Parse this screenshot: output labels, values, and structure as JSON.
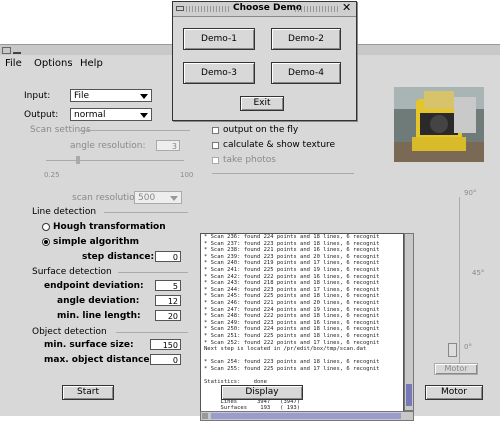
{
  "main_window": {
    "menu": [
      "File",
      "Options",
      "Help"
    ],
    "input_label": "Input:",
    "input_value": "File",
    "output_label": "Output:",
    "output_value": "normal",
    "scan_settings_label": "Scan settings",
    "angle_resolution_label": "angle resolution:",
    "angle_resolution_value": "3",
    "slider_min": "0.25",
    "slider_max": "100",
    "scan_resolution_label": "scan resolution:",
    "scan_resolution_value": "500",
    "line_detection_label": "Line detection",
    "hough_label": "Hough transformation",
    "simple_label": "simple algorithm",
    "step_distance_label": "step distance:",
    "step_distance_value": "0",
    "surface_detection_label": "Surface detection",
    "endpoint_deviation_label": "endpoint deviation:",
    "endpoint_deviation_value": "5",
    "angle_deviation_label": "angle deviation:",
    "angle_deviation_value": "12",
    "min_line_length_label": "min. line length:",
    "min_line_length_value": "20",
    "object_detection_label": "Object detection",
    "min_surface_size_label": "min. surface size:",
    "min_surface_size_value": "150",
    "max_object_distance_label": "max. object distance:",
    "max_object_distance_value": "0",
    "output_on_fly_label": "output on the fly",
    "calc_texture_label": "calculate & show texture",
    "take_photos_label": "take photos",
    "start_button": "Start",
    "display_button": "Display",
    "motor_button": "Motor",
    "gauge_top": "90°",
    "gauge_mid": "45°",
    "gauge_bottom": "0°",
    "gauge_button": "Motor"
  },
  "console_lines": [
    "* Scan 236: found 224 points and 18 lines, 6 recognit",
    "* Scan 237: found 223 points and 18 lines, 6 recognit",
    "* Scan 238: found 221 points and 16 lines, 6 recognit",
    "* Scan 239: found 223 points and 20 lines, 6 recognit",
    "* Scan 240: found 219 points and 17 lines, 6 recognit",
    "* Scan 241: found 225 points and 19 lines, 6 recognit",
    "* Scan 242: found 222 points and 16 lines, 6 recognit",
    "* Scan 243: found 218 points and 18 lines, 6 recognit",
    "* Scan 244: found 223 points and 17 lines, 6 recognit",
    "* Scan 245: found 225 points and 18 lines, 6 recognit",
    "* Scan 246: found 221 points and 20 lines, 6 recognit",
    "* Scan 247: found 224 points and 19 lines, 6 recognit",
    "* Scan 248: found 222 points and 18 lines, 6 recognit",
    "* Scan 249: found 223 points and 16 lines, 6 recognit",
    "* Scan 250: found 224 points and 18 lines, 6 recognit",
    "* Scan 251: found 225 points and 18 lines, 6 recognit",
    "* Scan 252: found 222 points and 17 lines, 6 recognit",
    "Next step is located in /pr/edit/box/tmp/scan.dat",
    "",
    "* Scan 254: found 223 points and 18 lines, 6 recognit",
    "* Scan 255: found 225 points and 17 lines, 6 recognit",
    "",
    "Statistics:    done",
    "",
    "     Points       0    (25633)",
    "     Lines      3947   (3947)",
    "     Surfaces    193   ( 193)",
    "     Objects     333"
  ],
  "dialog": {
    "title": "Choose Demo",
    "demo1": "Demo-1",
    "demo2": "Demo-2",
    "demo3": "Demo-3",
    "demo4": "Demo-4",
    "exit": "Exit"
  }
}
